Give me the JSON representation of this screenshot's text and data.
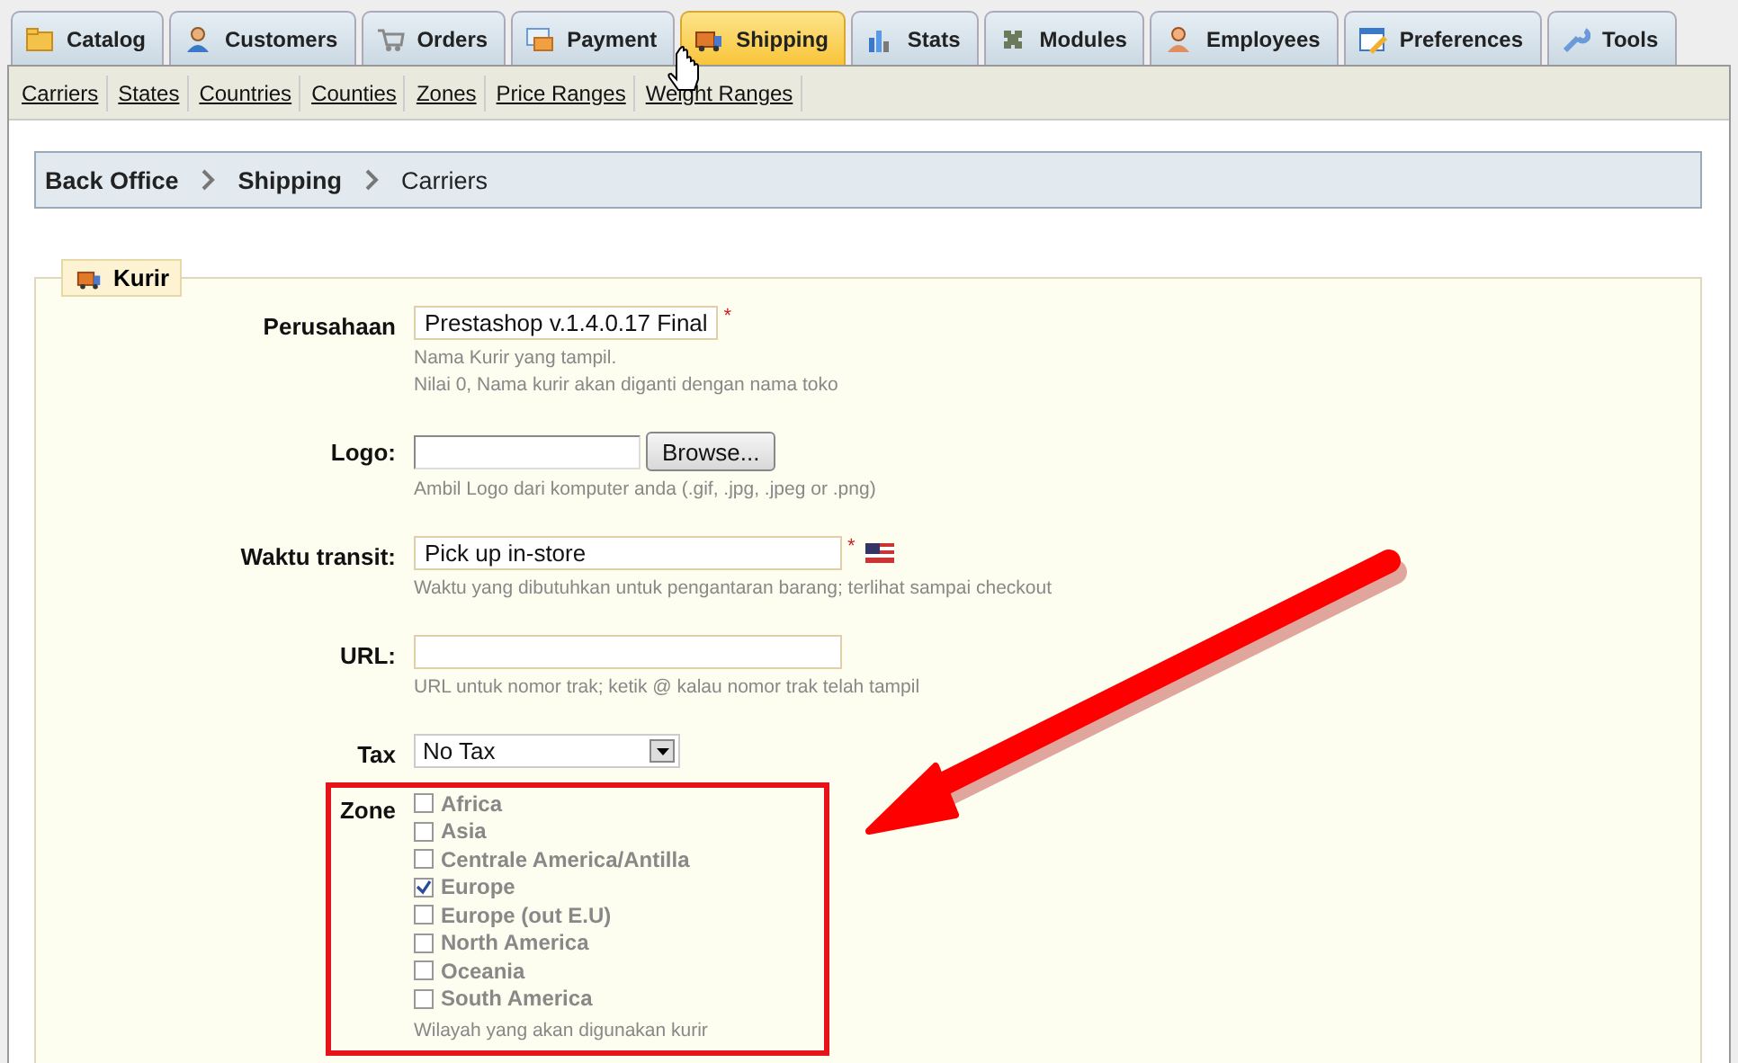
{
  "tabs": [
    {
      "label": "Catalog",
      "selected": false
    },
    {
      "label": "Customers",
      "selected": false
    },
    {
      "label": "Orders",
      "selected": false
    },
    {
      "label": "Payment",
      "selected": false
    },
    {
      "label": "Shipping",
      "selected": true
    },
    {
      "label": "Stats",
      "selected": false
    },
    {
      "label": "Modules",
      "selected": false
    },
    {
      "label": "Employees",
      "selected": false
    },
    {
      "label": "Preferences",
      "selected": false
    },
    {
      "label": "Tools",
      "selected": false
    }
  ],
  "subtabs": [
    "Carriers",
    "States",
    "Countries",
    "Counties",
    "Zones",
    "Price Ranges",
    "Weight Ranges"
  ],
  "breadcrumb": [
    "Back Office",
    "Shipping",
    "Carriers"
  ],
  "form": {
    "legend": "Kurir",
    "fields": [
      {
        "kind": "text",
        "label": "Perusahaan",
        "value": "Prestashop v.1.4.0.17 Final",
        "required_mark": "*",
        "help": [
          "Nama Kurir yang tampil.",
          "Nilai 0, Nama kurir akan diganti dengan nama toko"
        ]
      },
      {
        "kind": "file",
        "label": "Logo:",
        "button": "Browse...",
        "help": [
          "Ambil Logo dari komputer anda (.gif, .jpg, .jpeg or .png)"
        ]
      },
      {
        "kind": "text",
        "label": "Waktu transit:",
        "value": "Pick up in-store",
        "required_mark": "*",
        "flag": true,
        "help": [
          "Waktu yang dibutuhkan untuk pengantaran barang; terlihat sampai checkout"
        ]
      },
      {
        "kind": "text",
        "label": "URL:",
        "help": [
          "URL untuk nomor trak; ketik @ kalau nomor trak telah tampil"
        ]
      },
      {
        "kind": "select",
        "label": "Tax",
        "value": "No Tax"
      },
      {
        "kind": "checkboxes",
        "label": "Zone",
        "options": [
          {
            "label": "Africa",
            "checked": false
          },
          {
            "label": "Asia",
            "checked": false
          },
          {
            "label": "Centrale America/Antilla",
            "checked": false
          },
          {
            "label": "Europe",
            "checked": true
          },
          {
            "label": "Europe (out E.U)",
            "checked": false
          },
          {
            "label": "North America",
            "checked": false
          },
          {
            "label": "Oceania",
            "checked": false
          },
          {
            "label": "South America",
            "checked": false
          }
        ],
        "help": [
          "Wilayah yang akan digunakan kurir"
        ]
      }
    ]
  }
}
